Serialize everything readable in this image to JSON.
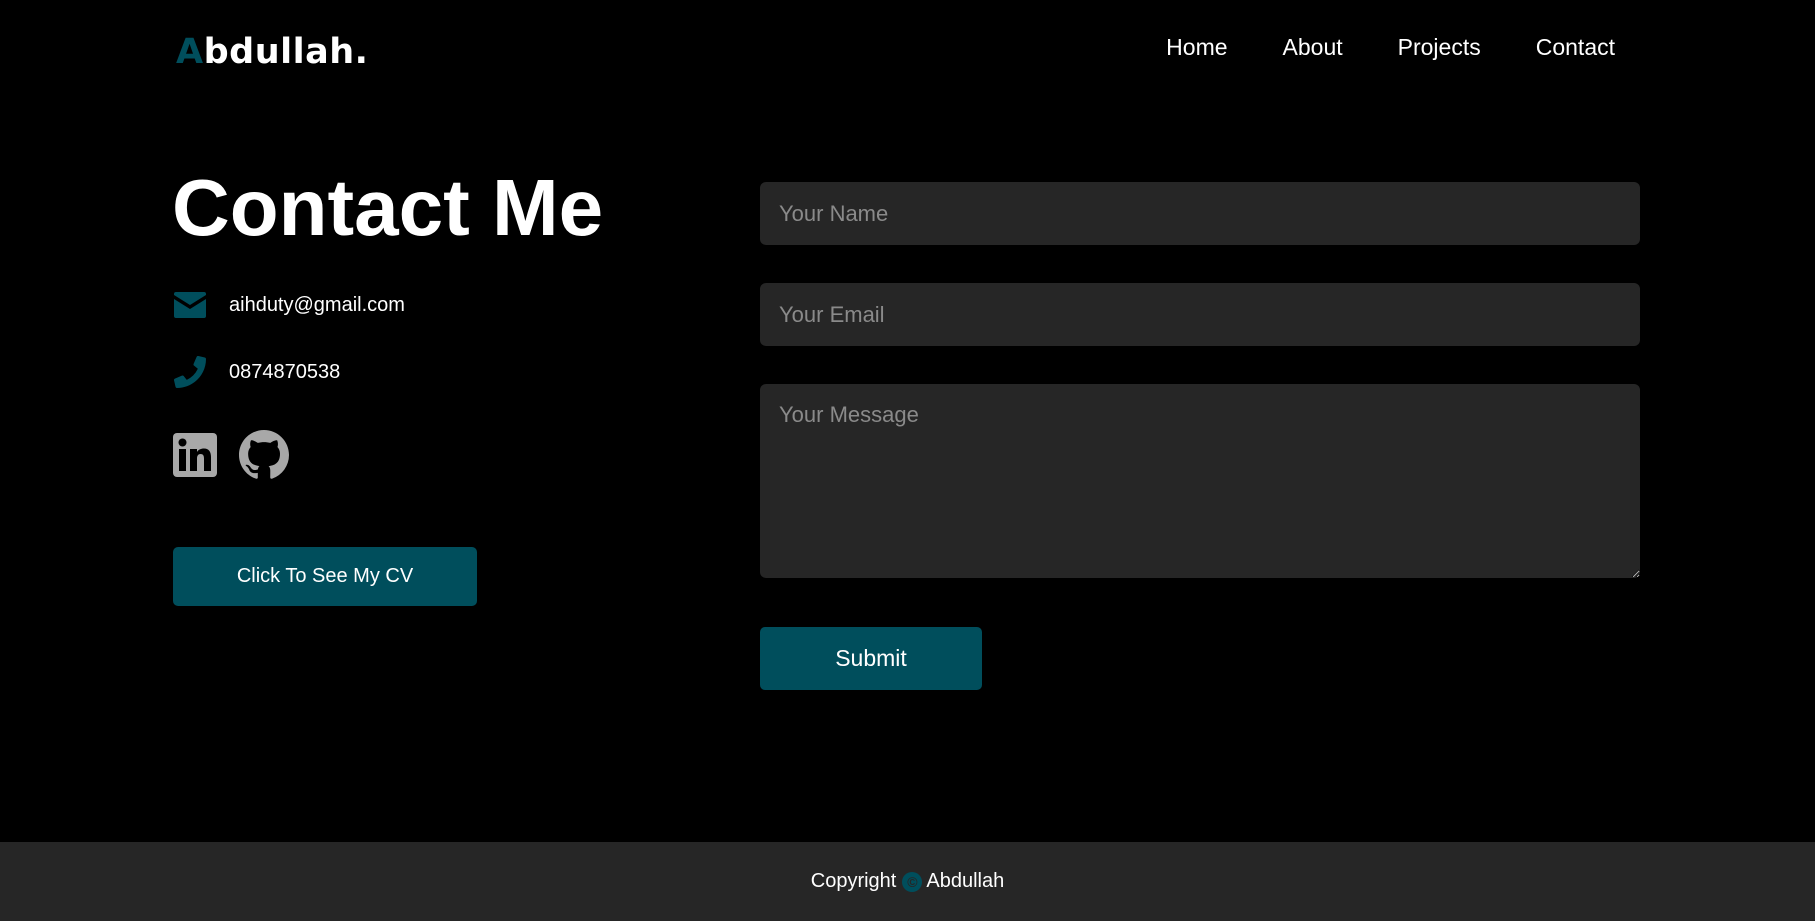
{
  "header": {
    "logo": {
      "accent": "A",
      "rest": "bdullah."
    },
    "nav": [
      "Home",
      "About",
      "Projects",
      "Contact"
    ]
  },
  "contact": {
    "heading": "Contact Me",
    "email": "aihduty@gmail.com",
    "phone": "0874870538",
    "socials": [
      "linkedin-icon",
      "github-icon"
    ],
    "cv_button": "Click To See My CV"
  },
  "form": {
    "name_placeholder": "Your Name",
    "email_placeholder": "Your Email",
    "message_placeholder": "Your Message",
    "submit_label": "Submit"
  },
  "footer": {
    "copyright_label": "Copyright",
    "copyright_symbol": "©",
    "owner": "Abdullah"
  },
  "colors": {
    "background": "#000000",
    "accent": "#004e5c",
    "field_background": "#262626",
    "icon_gray": "#a8a8a8",
    "text": "#ffffff"
  }
}
